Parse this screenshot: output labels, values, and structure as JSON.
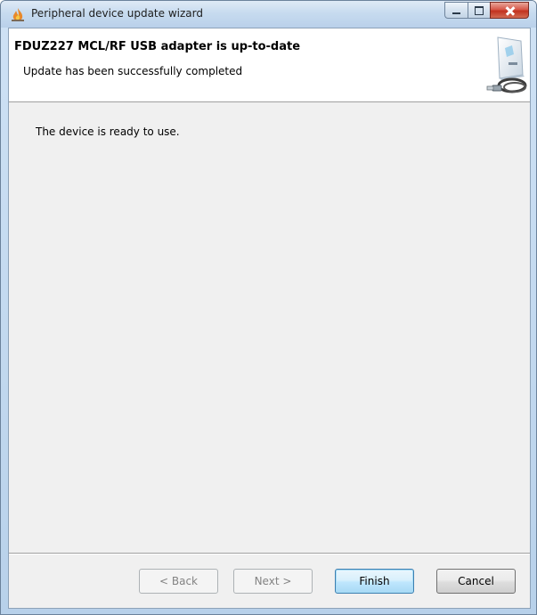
{
  "window": {
    "title": "Peripheral device update wizard",
    "icon": "wizard-flame-icon"
  },
  "caption": {
    "minimize": "minimize-icon",
    "maximize": "maximize-icon",
    "close": "close-icon"
  },
  "header": {
    "title": "FDUZ227 MCL/RF USB adapter is up-to-date",
    "subtitle": "Update has been successfully completed",
    "image": "usb-adapter-device-icon"
  },
  "content": {
    "message": "The device is ready to use."
  },
  "buttons": {
    "back": "< Back",
    "next": "Next >",
    "finish": "Finish",
    "cancel": "Cancel"
  },
  "colors": {
    "titlebar": "#c7dbef",
    "dialog_bg": "#f0f0f0",
    "close_red": "#c2321f",
    "default_button_border": "#3c7fb1"
  }
}
